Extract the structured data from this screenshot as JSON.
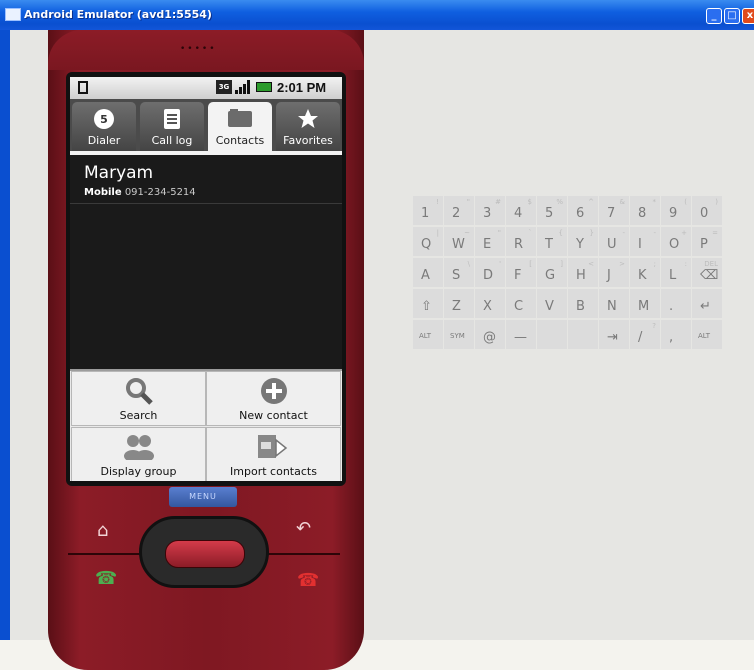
{
  "window": {
    "title": "Android Emulator (avd1:5554)",
    "min": "_",
    "max": "□",
    "close": "x"
  },
  "phone": {
    "speaker": "•••••",
    "status": {
      "network": "3G",
      "time": "2:01 PM"
    },
    "tabs": [
      {
        "label": "Dialer",
        "icon": "dialer-icon"
      },
      {
        "label": "Call log",
        "icon": "call-log-icon"
      },
      {
        "label": "Contacts",
        "icon": "contacts-icon",
        "selected": true
      },
      {
        "label": "Favorites",
        "icon": "star-icon"
      }
    ],
    "contact": {
      "name": "Maryam",
      "type": "Mobile",
      "number": "091-234-5214"
    },
    "menu": [
      {
        "label": "Search",
        "icon": "search-icon"
      },
      {
        "label": "New contact",
        "icon": "add-contact-icon"
      },
      {
        "label": "Display group",
        "icon": "group-icon"
      },
      {
        "label": "Import contacts",
        "icon": "import-sim-icon"
      }
    ],
    "menu_button": "MENU",
    "hw": {
      "home": "⌂",
      "back": "↶",
      "call": "☎",
      "end": "☎"
    }
  },
  "keyboard": {
    "rows": [
      [
        {
          "k": "1",
          "s": "!"
        },
        {
          "k": "2",
          "s": "\""
        },
        {
          "k": "3",
          "s": "#"
        },
        {
          "k": "4",
          "s": "$"
        },
        {
          "k": "5",
          "s": "%"
        },
        {
          "k": "6",
          "s": "^"
        },
        {
          "k": "7",
          "s": "&"
        },
        {
          "k": "8",
          "s": "*"
        },
        {
          "k": "9",
          "s": "("
        },
        {
          "k": "0",
          "s": ")"
        }
      ],
      [
        {
          "k": "Q",
          "s": "|"
        },
        {
          "k": "W",
          "s": "~"
        },
        {
          "k": "E",
          "s": "\""
        },
        {
          "k": "R",
          "s": "`"
        },
        {
          "k": "T",
          "s": "{"
        },
        {
          "k": "Y",
          "s": "}"
        },
        {
          "k": "U",
          "s": "-"
        },
        {
          "k": "I",
          "s": "-"
        },
        {
          "k": "O",
          "s": "+"
        },
        {
          "k": "P",
          "s": "="
        }
      ],
      [
        {
          "k": "A",
          "s": ""
        },
        {
          "k": "S",
          "s": "\\"
        },
        {
          "k": "D",
          "s": "'"
        },
        {
          "k": "F",
          "s": "["
        },
        {
          "k": "G",
          "s": "]"
        },
        {
          "k": "H",
          "s": "<"
        },
        {
          "k": "J",
          "s": ">"
        },
        {
          "k": "K",
          "s": ";"
        },
        {
          "k": "L",
          "s": ":"
        },
        {
          "k": "⌫",
          "s": "DEL"
        }
      ],
      [
        {
          "k": "⇧",
          "s": ""
        },
        {
          "k": "Z",
          "s": ""
        },
        {
          "k": "X",
          "s": ""
        },
        {
          "k": "C",
          "s": ""
        },
        {
          "k": "V",
          "s": ""
        },
        {
          "k": "B",
          "s": ""
        },
        {
          "k": "N",
          "s": ""
        },
        {
          "k": "M",
          "s": ""
        },
        {
          "k": ".",
          "s": ""
        },
        {
          "k": "↵",
          "s": ""
        }
      ],
      [
        {
          "k": "ALT",
          "s": ""
        },
        {
          "k": "SYM",
          "s": ""
        },
        {
          "k": "@",
          "s": ""
        },
        {
          "k": "—",
          "s": ""
        },
        {
          "k": "",
          "s": ""
        },
        {
          "k": "",
          "s": ""
        },
        {
          "k": "⇥",
          "s": ""
        },
        {
          "k": "/",
          "s": "?"
        },
        {
          "k": ",",
          "s": ""
        },
        {
          "k": "ALT",
          "s": ""
        }
      ]
    ]
  }
}
